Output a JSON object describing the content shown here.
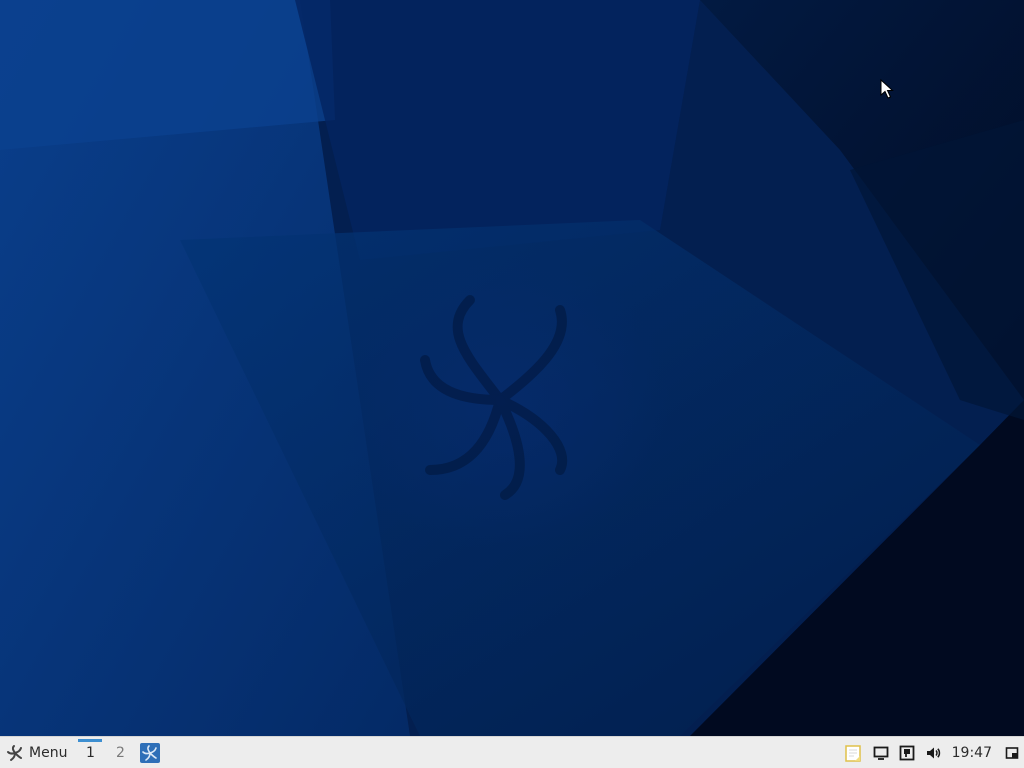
{
  "desktop": {
    "background_color": "#031d4a",
    "wallpaper": "blue-swirl-wallpaper",
    "cursor_icon": "arrow-cursor-icon"
  },
  "taskbar": {
    "menu": {
      "label": "Menu",
      "icon": "distro-swirl-logo-icon"
    },
    "workspaces": [
      {
        "label": "1",
        "active": true
      },
      {
        "label": "2",
        "active": false
      }
    ],
    "pinned_app_icon": "swirl-app-icon",
    "tray": {
      "icons": [
        "notes-icon",
        "display-icon",
        "network-icon",
        "volume-icon"
      ],
      "clock": "19:47",
      "show_desktop_icon": "show-desktop-icon"
    },
    "accent_color": "#3d8fd1",
    "background_color": "#ededed"
  }
}
